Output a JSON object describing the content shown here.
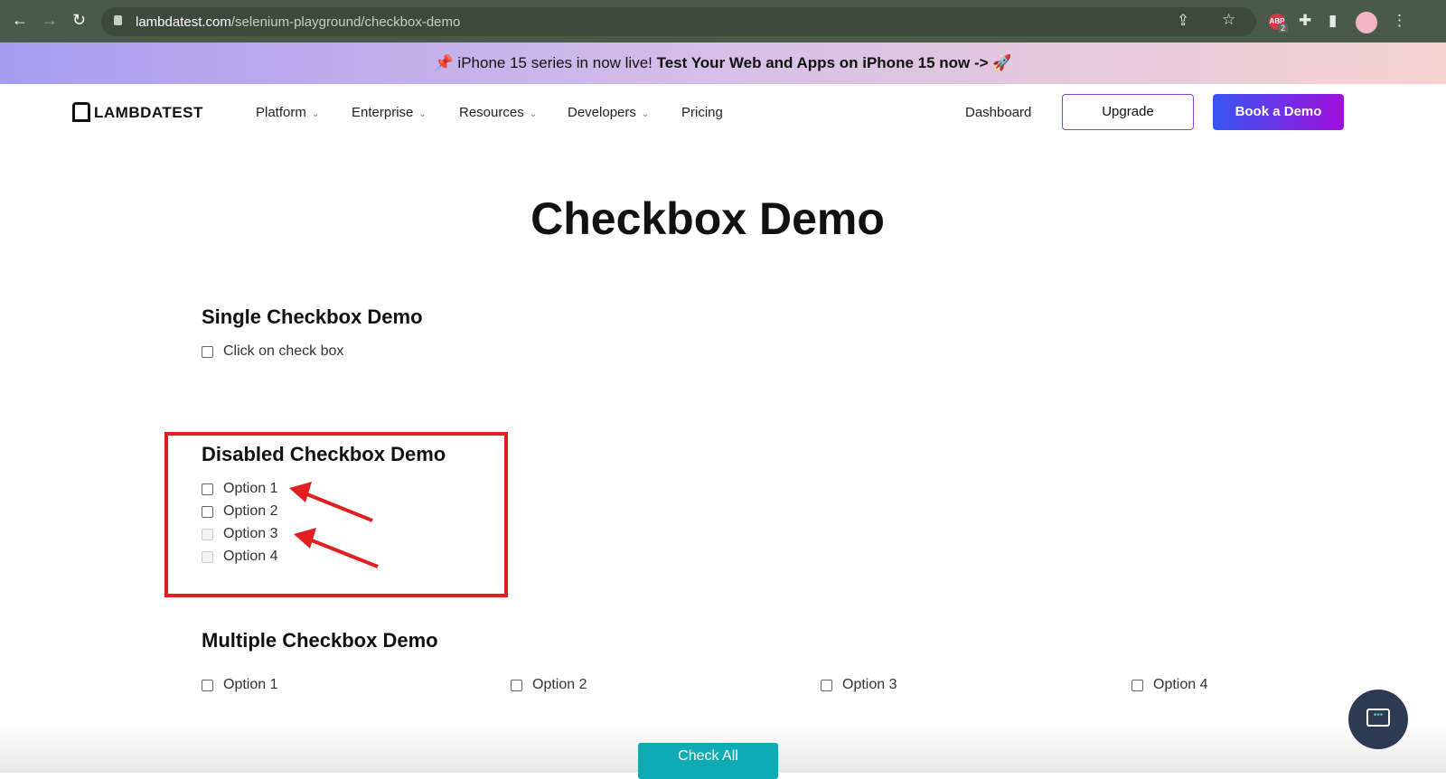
{
  "browser": {
    "url_domain": "lambdatest.com",
    "url_path": "/selenium-playground/checkbox-demo",
    "ext_badge": "ABP",
    "ext_count": "2"
  },
  "banner": {
    "text": "iPhone 15 series in now live! ",
    "bold": "Test Your Web and Apps on iPhone 15 now ->",
    "emoji_left": "📌",
    "emoji_right": "🚀"
  },
  "nav": {
    "logo": "LAMBDATEST",
    "items": [
      "Platform",
      "Enterprise",
      "Resources",
      "Developers",
      "Pricing"
    ],
    "dashboard": "Dashboard",
    "upgrade": "Upgrade",
    "book_demo": "Book a Demo"
  },
  "page": {
    "title": "Checkbox Demo",
    "single": {
      "heading": "Single Checkbox Demo",
      "label": "Click on check box"
    },
    "disabled": {
      "heading": "Disabled Checkbox Demo",
      "options": [
        "Option 1",
        "Option 2",
        "Option 3",
        "Option 4"
      ]
    },
    "multiple": {
      "heading": "Multiple Checkbox Demo",
      "options": [
        "Option 1",
        "Option 2",
        "Option 3",
        "Option 4"
      ],
      "button": "Check All"
    }
  },
  "annotation_color": "#e02020"
}
